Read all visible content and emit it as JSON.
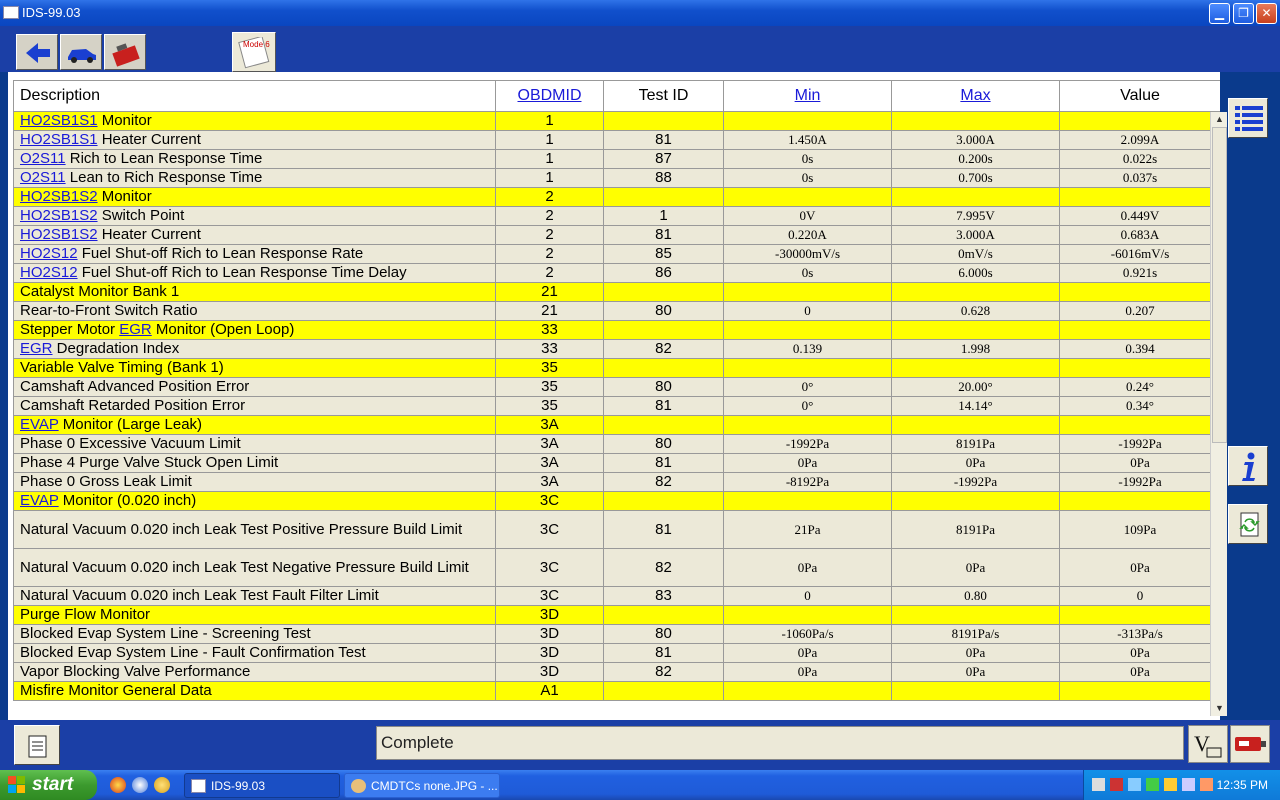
{
  "window": {
    "title": "IDS-99.03"
  },
  "toolbar": {
    "mode6_label": "Mode 6"
  },
  "table": {
    "headers": [
      "Description",
      "OBDMID",
      "Test ID",
      "Min",
      "Max",
      "Value"
    ],
    "rows": [
      {
        "type": "group",
        "link": "HO2SB1S1",
        "desc": " Monitor",
        "obdmid": "1",
        "test_id": "",
        "min": "",
        "max": "",
        "value": ""
      },
      {
        "type": "normal",
        "link": "HO2SB1S1",
        "desc": " Heater Current",
        "obdmid": "1",
        "test_id": "81",
        "min": "1.450A",
        "max": "3.000A",
        "value": "2.099A"
      },
      {
        "type": "normal",
        "link": "O2S11",
        "desc": " Rich to Lean Response Time",
        "obdmid": "1",
        "test_id": "87",
        "min": "0s",
        "max": "0.200s",
        "value": "0.022s"
      },
      {
        "type": "normal",
        "link": "O2S11",
        "desc": " Lean to Rich Response Time",
        "obdmid": "1",
        "test_id": "88",
        "min": "0s",
        "max": "0.700s",
        "value": "0.037s"
      },
      {
        "type": "group",
        "link": "HO2SB1S2",
        "desc": " Monitor",
        "obdmid": "2",
        "test_id": "",
        "min": "",
        "max": "",
        "value": ""
      },
      {
        "type": "normal",
        "link": "HO2SB1S2",
        "desc": " Switch Point",
        "obdmid": "2",
        "test_id": "1",
        "min": "0V",
        "max": "7.995V",
        "value": "0.449V"
      },
      {
        "type": "normal",
        "link": "HO2SB1S2",
        "desc": " Heater Current",
        "obdmid": "2",
        "test_id": "81",
        "min": "0.220A",
        "max": "3.000A",
        "value": "0.683A"
      },
      {
        "type": "normal",
        "link": "HO2S12",
        "desc": " Fuel Shut-off Rich to Lean Response Rate",
        "obdmid": "2",
        "test_id": "85",
        "min": "-30000mV/s",
        "max": "0mV/s",
        "value": "-6016mV/s"
      },
      {
        "type": "normal",
        "link": "HO2S12",
        "desc": " Fuel Shut-off Rich to Lean Response Time Delay",
        "obdmid": "2",
        "test_id": "86",
        "min": "0s",
        "max": "6.000s",
        "value": "0.921s"
      },
      {
        "type": "group",
        "link": "",
        "desc": "Catalyst Monitor Bank 1",
        "obdmid": "21",
        "test_id": "",
        "min": "",
        "max": "",
        "value": ""
      },
      {
        "type": "normal",
        "link": "",
        "desc": "Rear-to-Front Switch Ratio",
        "obdmid": "21",
        "test_id": "80",
        "min": "0",
        "max": "0.628",
        "value": "0.207"
      },
      {
        "type": "group",
        "pre": "Stepper Motor ",
        "link": "EGR",
        "desc": " Monitor (Open Loop)",
        "obdmid": "33",
        "test_id": "",
        "min": "",
        "max": "",
        "value": ""
      },
      {
        "type": "normal",
        "link": "EGR",
        "desc": " Degradation Index",
        "obdmid": "33",
        "test_id": "82",
        "min": "0.139",
        "max": "1.998",
        "value": "0.394"
      },
      {
        "type": "group",
        "link": "",
        "desc": "Variable Valve Timing (Bank 1)",
        "obdmid": "35",
        "test_id": "",
        "min": "",
        "max": "",
        "value": ""
      },
      {
        "type": "normal",
        "link": "",
        "desc": "Camshaft Advanced Position Error",
        "obdmid": "35",
        "test_id": "80",
        "min": "0°",
        "max": "20.00°",
        "value": "0.24°"
      },
      {
        "type": "normal",
        "link": "",
        "desc": "Camshaft Retarded Position Error",
        "obdmid": "35",
        "test_id": "81",
        "min": "0°",
        "max": "14.14°",
        "value": "0.34°"
      },
      {
        "type": "group",
        "link": "EVAP",
        "desc": " Monitor (Large Leak)",
        "obdmid": "3A",
        "test_id": "",
        "min": "",
        "max": "",
        "value": ""
      },
      {
        "type": "normal",
        "link": "",
        "desc": "Phase 0 Excessive Vacuum Limit",
        "obdmid": "3A",
        "test_id": "80",
        "min": "-1992Pa",
        "max": "8191Pa",
        "value": "-1992Pa"
      },
      {
        "type": "normal",
        "link": "",
        "desc": "Phase 4 Purge Valve Stuck Open Limit",
        "obdmid": "3A",
        "test_id": "81",
        "min": "0Pa",
        "max": "0Pa",
        "value": "0Pa"
      },
      {
        "type": "normal",
        "link": "",
        "desc": "Phase 0 Gross Leak Limit",
        "obdmid": "3A",
        "test_id": "82",
        "min": "-8192Pa",
        "max": "-1992Pa",
        "value": "-1992Pa"
      },
      {
        "type": "group",
        "link": "EVAP",
        "desc": " Monitor (0.020 inch)",
        "obdmid": "3C",
        "test_id": "",
        "min": "",
        "max": "",
        "value": ""
      },
      {
        "type": "tall",
        "link": "",
        "desc": "Natural Vacuum 0.020 inch Leak Test Positive Pressure Build Limit",
        "obdmid": "3C",
        "test_id": "81",
        "min": "21Pa",
        "max": "8191Pa",
        "value": "109Pa"
      },
      {
        "type": "tall",
        "link": "",
        "desc": "Natural Vacuum 0.020 inch Leak Test Negative Pressure Build Limit",
        "obdmid": "3C",
        "test_id": "82",
        "min": "0Pa",
        "max": "0Pa",
        "value": "0Pa"
      },
      {
        "type": "normal",
        "link": "",
        "desc": "Natural Vacuum 0.020 inch Leak Test Fault Filter Limit",
        "obdmid": "3C",
        "test_id": "83",
        "min": "0",
        "max": "0.80",
        "value": "0"
      },
      {
        "type": "group",
        "link": "",
        "desc": "Purge Flow Monitor",
        "obdmid": "3D",
        "test_id": "",
        "min": "",
        "max": "",
        "value": ""
      },
      {
        "type": "normal",
        "link": "",
        "desc": "Blocked Evap System Line - Screening Test",
        "obdmid": "3D",
        "test_id": "80",
        "min": "-1060Pa/s",
        "max": "8191Pa/s",
        "value": "-313Pa/s"
      },
      {
        "type": "normal",
        "link": "",
        "desc": "Blocked Evap System Line - Fault Confirmation Test",
        "obdmid": "3D",
        "test_id": "81",
        "min": "0Pa",
        "max": "0Pa",
        "value": "0Pa"
      },
      {
        "type": "normal",
        "link": "",
        "desc": "Vapor Blocking Valve Performance",
        "obdmid": "3D",
        "test_id": "82",
        "min": "0Pa",
        "max": "0Pa",
        "value": "0Pa"
      },
      {
        "type": "group",
        "link": "",
        "desc": "Misfire Monitor General Data",
        "obdmid": "A1",
        "test_id": "",
        "min": "",
        "max": "",
        "value": ""
      }
    ]
  },
  "status": {
    "text": "Complete"
  },
  "taskbar": {
    "start_label": "start",
    "tasks": [
      "IDS-99.03",
      "CMDTCs none.JPG - ..."
    ],
    "clock": "12:35 PM"
  }
}
